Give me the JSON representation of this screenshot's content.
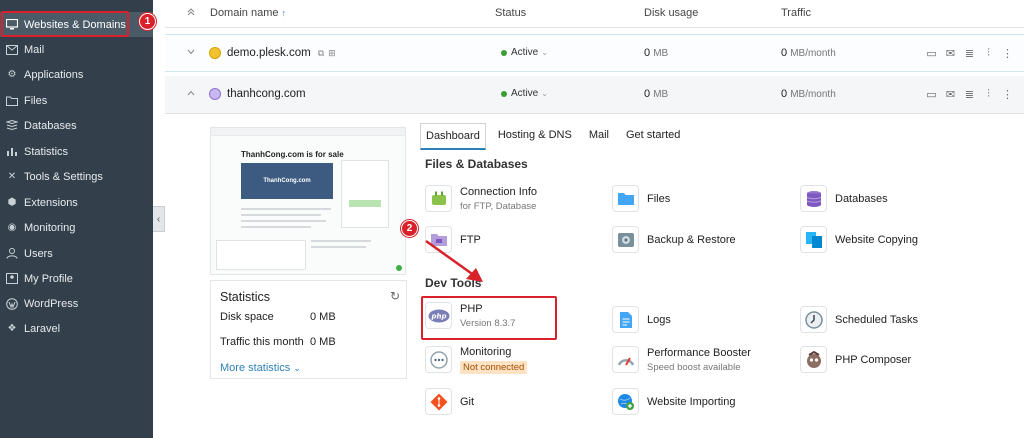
{
  "sidebar": {
    "items": [
      {
        "label": "Websites & Domains",
        "icon": "monitor-icon"
      },
      {
        "label": "Mail",
        "icon": "mail-icon"
      },
      {
        "label": "Applications",
        "icon": "gear-icon"
      },
      {
        "label": "Files",
        "icon": "folder-icon"
      },
      {
        "label": "Databases",
        "icon": "database-icon"
      },
      {
        "label": "Statistics",
        "icon": "chart-icon"
      },
      {
        "label": "Tools & Settings",
        "icon": "tools-icon"
      },
      {
        "label": "Extensions",
        "icon": "puzzle-icon"
      },
      {
        "label": "Monitoring",
        "icon": "monitoring-icon"
      },
      {
        "label": "Users",
        "icon": "user-icon"
      },
      {
        "label": "My Profile",
        "icon": "profile-icon"
      },
      {
        "label": "WordPress",
        "icon": "wordpress-icon"
      },
      {
        "label": "Laravel",
        "icon": "laravel-icon"
      }
    ],
    "collapse_glyph": "‹"
  },
  "markers": {
    "step1": "1",
    "step2": "2"
  },
  "table": {
    "headers": {
      "domain": "Domain name",
      "status": "Status",
      "disk": "Disk usage",
      "traffic": "Traffic"
    },
    "sort_indicator": "↑",
    "rows": [
      {
        "name": "demo.plesk.com",
        "status": "Active",
        "disk_value": "0",
        "disk_unit": "MB",
        "traffic_value": "0",
        "traffic_unit": "MB/month"
      },
      {
        "name": "thanhcong.com",
        "status": "Active",
        "disk_value": "0",
        "disk_unit": "MB",
        "traffic_value": "0",
        "traffic_unit": "MB/month"
      }
    ]
  },
  "preview": {
    "hero_title": "ThanhCong.com is for sale",
    "hero_image_text": "ThanhCong.com"
  },
  "stats": {
    "title": "Statistics",
    "disk_label": "Disk space",
    "disk_value": "0 MB",
    "traffic_label": "Traffic this month",
    "traffic_value": "0 MB",
    "more_label": "More statistics"
  },
  "tabs": [
    "Dashboard",
    "Hosting & DNS",
    "Mail",
    "Get started"
  ],
  "sections": {
    "files_db": "Files & Databases",
    "dev_tools": "Dev Tools"
  },
  "tools": {
    "connection_info": {
      "name": "Connection Info",
      "sub": "for FTP, Database"
    },
    "files": {
      "name": "Files"
    },
    "databases": {
      "name": "Databases"
    },
    "ftp": {
      "name": "FTP"
    },
    "backup": {
      "name": "Backup & Restore"
    },
    "website_copying": {
      "name": "Website Copying"
    },
    "php": {
      "name": "PHP",
      "sub": "Version 8.3.7",
      "icon_text": "php"
    },
    "logs": {
      "name": "Logs"
    },
    "scheduled_tasks": {
      "name": "Scheduled Tasks"
    },
    "monitoring": {
      "name": "Monitoring",
      "sub": "Not connected"
    },
    "performance_booster": {
      "name": "Performance Booster",
      "sub": "Speed boost available"
    },
    "php_composer": {
      "name": "PHP Composer"
    },
    "git": {
      "name": "Git"
    },
    "website_importing": {
      "name": "Website Importing"
    }
  },
  "colors": {
    "sidebar_bg": "#33404b",
    "accent": "#2d81b8",
    "highlight": "#d8212a",
    "active_status": "#3c9e32"
  }
}
